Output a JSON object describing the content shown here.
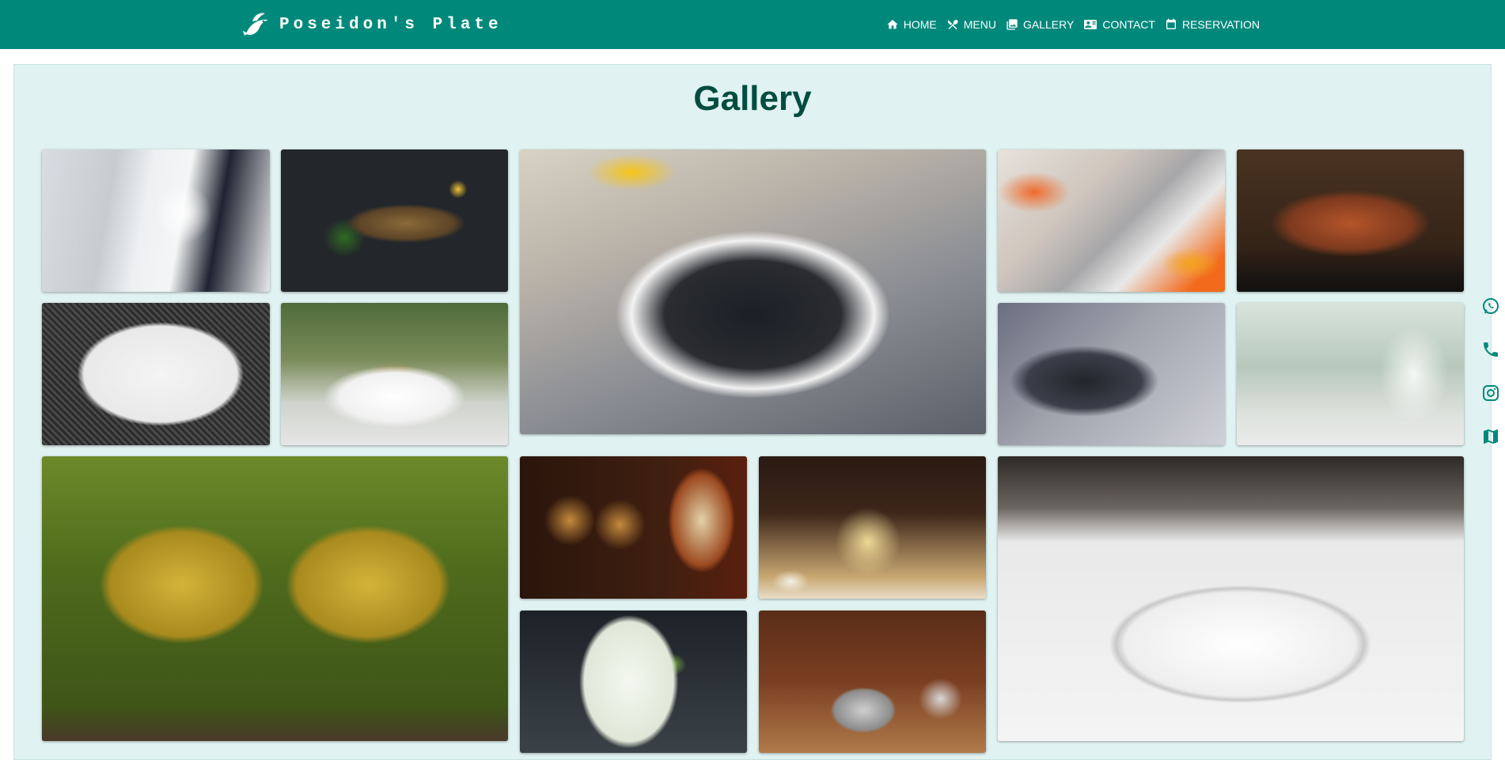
{
  "brand": {
    "name": "Poseidon's Plate",
    "logo_icon": "fish-logo-icon"
  },
  "nav": {
    "items": [
      {
        "label": "HOME",
        "icon": "home-icon"
      },
      {
        "label": "MENU",
        "icon": "utensils-icon"
      },
      {
        "label": "GALLERY",
        "icon": "gallery-icon"
      },
      {
        "label": "CONTACT",
        "icon": "contact-card-icon"
      },
      {
        "label": "RESERVATION",
        "icon": "calendar-icon"
      }
    ]
  },
  "page": {
    "title": "Gallery"
  },
  "gallery": {
    "photos": [
      {
        "subject": "chef-cooking",
        "icon": "chef-photo"
      },
      {
        "subject": "grilled-fish",
        "icon": "grilled-fish-photo"
      },
      {
        "subject": "mussels-plate",
        "icon": "mussels-photo"
      },
      {
        "subject": "seafood-on-ice",
        "icon": "seafood-display-photo"
      },
      {
        "subject": "lobster-platter",
        "icon": "lobster-photo"
      },
      {
        "subject": "prawns-plate",
        "icon": "prawns-photo"
      },
      {
        "subject": "fried-fish-dish",
        "icon": "fried-fish-photo"
      },
      {
        "subject": "sushi-rolls",
        "icon": "sushi-photo"
      },
      {
        "subject": "wine-glasses",
        "icon": "wine-glasses-photo"
      },
      {
        "subject": "brandy-glasses",
        "icon": "brandy-glasses-photo"
      },
      {
        "subject": "rum-bottle-glasses",
        "icon": "rum-photo"
      },
      {
        "subject": "champagne-table",
        "icon": "champagne-photo"
      },
      {
        "subject": "octopus-dish",
        "icon": "octopus-photo"
      },
      {
        "subject": "lime-cocktail",
        "icon": "cocktail-photo"
      },
      {
        "subject": "turkish-coffee",
        "icon": "coffee-photo"
      }
    ]
  },
  "social": [
    {
      "icon": "whatsapp-icon"
    },
    {
      "icon": "phone-icon"
    },
    {
      "icon": "instagram-icon"
    },
    {
      "icon": "map-icon"
    }
  ],
  "colors": {
    "navbar": "#00897b",
    "page_background": "#e0f2f1",
    "title": "#004d40",
    "social_icons": "#00897b"
  }
}
